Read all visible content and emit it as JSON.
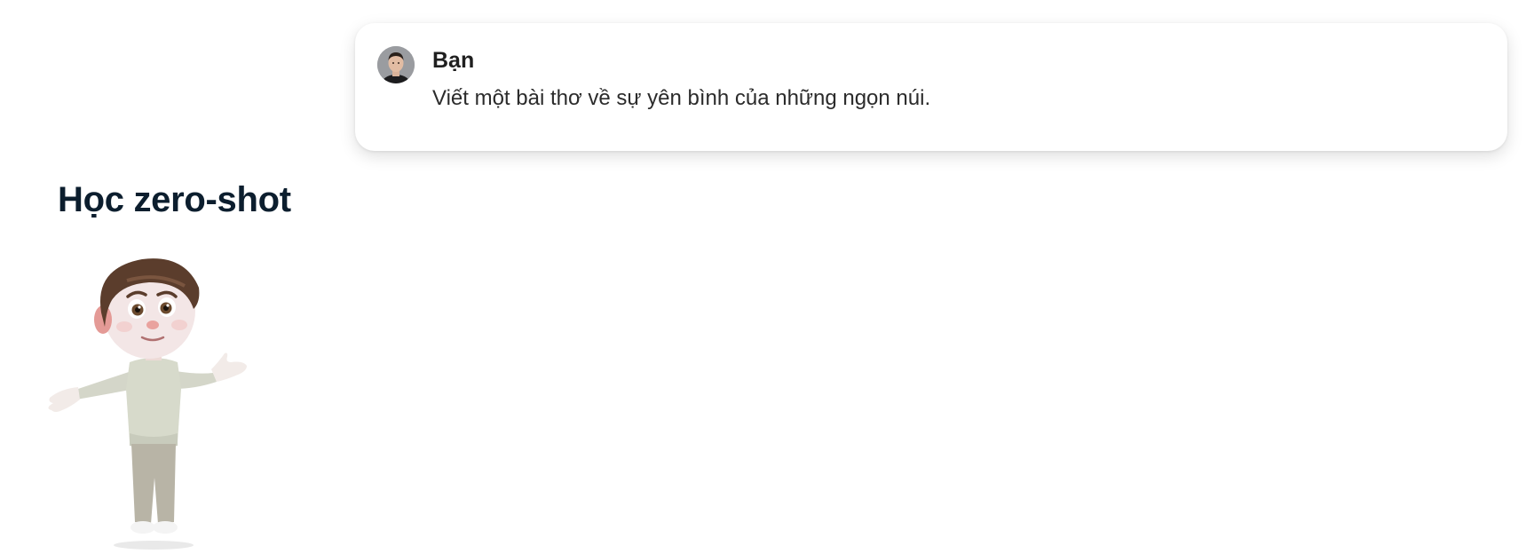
{
  "chat": {
    "author": "Bạn",
    "message": "Viết một bài thơ về sự yên bình của những ngọn núi."
  },
  "section": {
    "title": "Học zero-shot"
  },
  "icons": {
    "avatar": "user-avatar",
    "character": "cartoon-boy-shrugging-illustration"
  }
}
